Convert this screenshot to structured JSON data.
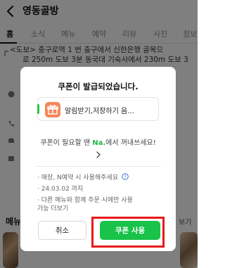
{
  "header": {
    "title": "영동골방"
  },
  "tabs": [
    "홈",
    "소식",
    "메뉴",
    "예약",
    "리뷰",
    "사진",
    "정보"
  ],
  "address": {
    "line1": "<도보> 중구로역 1 번 출구에서 신한은행 골목으",
    "line2": "로 250m 도보 3분 동국대 기숙사에서 230m 도보 3"
  },
  "menu_section": {
    "heading": "메뉴",
    "more": "보기"
  },
  "dialog": {
    "title": "쿠폰이 발급되었습니다.",
    "coupon_name": "알림받기,저장하기 음...",
    "hint_prefix": "쿠폰이 필요할 땐 ",
    "hint_brand": "Na.",
    "hint_suffix": "에서 꺼내쓰세요!",
    "notes": [
      "· 매장, N예약 시 사용해주세요",
      "· 24.03.02 까지",
      "· 다른 메뉴와 함께 주문 시에만 사용",
      "  가능 더보기"
    ],
    "cancel_label": "취소",
    "use_label": "쿠폰 사용"
  },
  "colors": {
    "accent_green": "#19c248",
    "highlight_red": "#e81919",
    "gift_orange": "#f5875a"
  }
}
